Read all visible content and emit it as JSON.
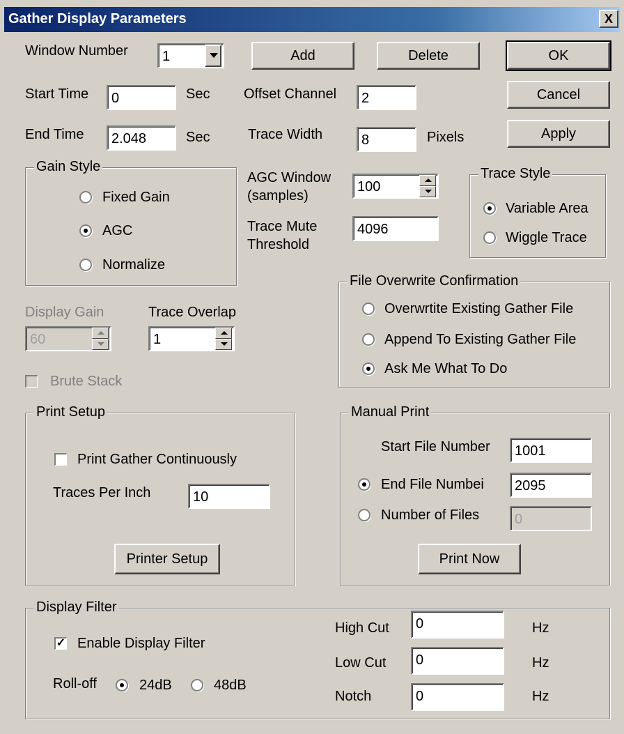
{
  "window": {
    "title": "Gather Display Parameters",
    "close_label": "X"
  },
  "top": {
    "window_number_label": "Window Number",
    "window_number_value": "1",
    "add_label": "Add",
    "delete_label": "Delete",
    "ok_label": "OK",
    "cancel_label": "Cancel",
    "apply_label": "Apply",
    "start_time_label": "Start Time",
    "start_time_value": "0",
    "start_time_unit": "Sec",
    "end_time_label": "End Time",
    "end_time_value": "2.048",
    "end_time_unit": "Sec",
    "offset_channel_label": "Offset Channel",
    "offset_channel_value": "2",
    "trace_width_label": "Trace Width",
    "trace_width_value": "8",
    "trace_width_unit": "Pixels"
  },
  "gain_style": {
    "title": "Gain Style",
    "options": [
      "Fixed Gain",
      "AGC",
      "Normalize"
    ],
    "selected": "AGC"
  },
  "agc": {
    "window_label_1": "AGC Window",
    "window_label_2": "(samples)",
    "window_value": "100",
    "mute_label_1": "Trace Mute",
    "mute_label_2": "Threshold",
    "mute_value": "4096"
  },
  "trace_style": {
    "title": "Trace Style",
    "options": [
      "Variable Area",
      "Wiggle Trace"
    ],
    "selected": "Variable Area"
  },
  "display": {
    "display_gain_label": "Display Gain",
    "display_gain_value": "60",
    "trace_overlap_label": "Trace Overlap",
    "trace_overlap_value": "1",
    "brute_stack_label": "Brute Stack"
  },
  "file_overwrite": {
    "title": "File Overwrite Confirmation",
    "options": [
      "Overwrtite Existing Gather File",
      "Append To Existing Gather File",
      "Ask Me What To Do"
    ],
    "selected": "Ask Me What To Do"
  },
  "print_setup": {
    "title": "Print Setup",
    "print_continuously_label": "Print Gather Continuously",
    "traces_per_inch_label": "Traces Per Inch",
    "traces_per_inch_value": "10",
    "printer_setup_label": "Printer Setup"
  },
  "manual_print": {
    "title": "Manual Print",
    "start_file_label": "Start File Number",
    "start_file_value": "1001",
    "end_file_label": "End File Numbei",
    "end_file_value": "2095",
    "num_files_label": "Number of Files",
    "num_files_value": "0",
    "print_now_label": "Print Now"
  },
  "display_filter": {
    "title": "Display Filter",
    "enable_label": "Enable Display Filter",
    "rolloff_label": "Roll-off",
    "rolloff_options": [
      "24dB",
      "48dB"
    ],
    "rolloff_selected": "24dB",
    "high_cut_label": "High Cut",
    "high_cut_value": "0",
    "low_cut_label": "Low Cut",
    "low_cut_value": "0",
    "notch_label": "Notch",
    "notch_value": "0",
    "unit": "Hz"
  }
}
